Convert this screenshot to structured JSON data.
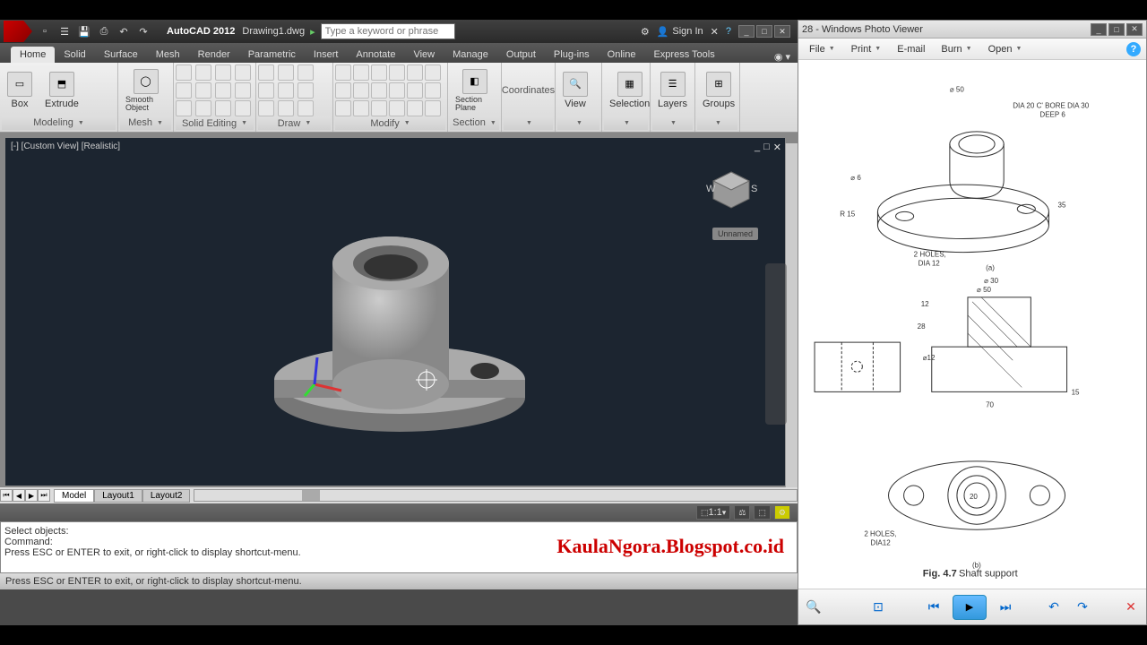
{
  "autocad": {
    "title": "AutoCAD 2012",
    "document": "Drawing1.dwg",
    "search_placeholder": "Type a keyword or phrase",
    "signin": "Sign In",
    "tabs": [
      "Home",
      "Solid",
      "Surface",
      "Mesh",
      "Render",
      "Parametric",
      "Insert",
      "Annotate",
      "View",
      "Manage",
      "Output",
      "Plug-ins",
      "Online",
      "Express Tools"
    ],
    "active_tab": "Home",
    "ribbon_panels": {
      "modeling": {
        "label": "Modeling",
        "box": "Box",
        "extrude": "Extrude",
        "smooth": "Smooth Object"
      },
      "mesh": {
        "label": "Mesh"
      },
      "solid_editing": {
        "label": "Solid Editing"
      },
      "draw": {
        "label": "Draw"
      },
      "modify": {
        "label": "Modify"
      },
      "section": {
        "label": "Section",
        "plane": "Section Plane"
      },
      "coordinates": {
        "label": "Coordinates"
      },
      "view": {
        "label": "View"
      },
      "selection": {
        "label": "Selection"
      },
      "layers": {
        "label": "Layers"
      },
      "groups": {
        "label": "Groups"
      }
    },
    "viewport_label": "[-] [Custom View] [Realistic]",
    "navcube_label": "Unnamed",
    "layout_tabs": [
      "Model",
      "Layout1",
      "Layout2"
    ],
    "active_layout": "Model",
    "scale": "1:1",
    "command_lines": [
      "Select objects:",
      "Command:",
      "Press ESC or ENTER to exit, or right-click to display shortcut-menu."
    ],
    "status_text": "Press ESC or ENTER to exit, or right-click to display shortcut-menu.",
    "watermark": "KaulaNgora.Blogspot.co.id"
  },
  "photoviewer": {
    "title": "28 - Windows Photo Viewer",
    "menu": [
      "File",
      "Print",
      "E-mail",
      "Burn",
      "Open"
    ],
    "drawing": {
      "title": "Fig. 4.7",
      "subtitle": "Shaft support",
      "iso_note": "DIA 20 C' BORE DIA 30",
      "iso_note2": "DEEP 6",
      "holes_note": "2 HOLES,",
      "holes_dia": "DIA 12",
      "holes_dia2": "DIA12",
      "label_a": "(a)",
      "label_b": "(b)",
      "dim_phi50_top": "⌀ 50",
      "dim_phi50": "⌀ 50",
      "dim_phi30": "⌀ 30",
      "dim_phi6": "⌀ 6",
      "dim_r15": "R 15",
      "dim_35": "35",
      "dim_28": "28",
      "dim_12": "12",
      "dim_15": "15",
      "dim_70": "70",
      "dim_phi12": "⌀12",
      "dim_20": "20"
    }
  }
}
